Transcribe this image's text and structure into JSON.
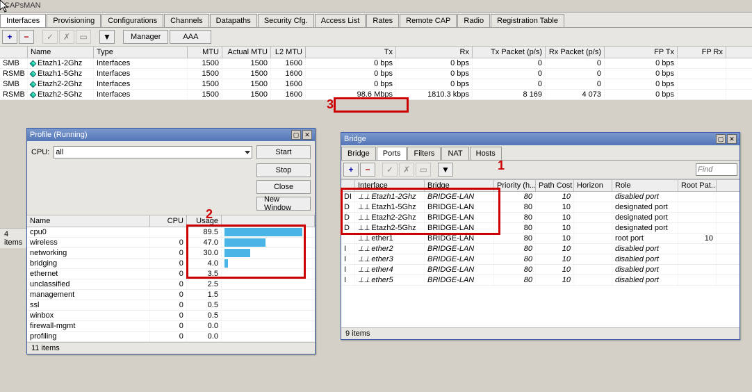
{
  "app": {
    "title": "CAPsMAN"
  },
  "main_tabs": [
    "Interfaces",
    "Provisioning",
    "Configurations",
    "Channels",
    "Datapaths",
    "Security Cfg.",
    "Access List",
    "Rates",
    "Remote CAP",
    "Radio",
    "Registration Table"
  ],
  "toolbar": {
    "manager": "Manager",
    "aaa": "AAA"
  },
  "grid": {
    "headers": [
      "",
      "Name",
      "Type",
      "MTU",
      "Actual MTU",
      "L2 MTU",
      "Tx",
      "Rx",
      "Tx Packet (p/s)",
      "Rx Packet (p/s)",
      "FP Tx",
      "FP Rx"
    ],
    "rows": [
      {
        "flags": "SMB",
        "name": "Etazh1-2Ghz",
        "type": "Interfaces",
        "mtu": "1500",
        "amtu": "1500",
        "l2mtu": "1600",
        "tx": "0 bps",
        "rx": "0 bps",
        "txp": "0",
        "rxp": "0",
        "fptx": "0 bps",
        "fprx": ""
      },
      {
        "flags": "RSMB",
        "name": "Etazh1-5Ghz",
        "type": "Interfaces",
        "mtu": "1500",
        "amtu": "1500",
        "l2mtu": "1600",
        "tx": "0 bps",
        "rx": "0 bps",
        "txp": "0",
        "rxp": "0",
        "fptx": "0 bps",
        "fprx": ""
      },
      {
        "flags": "SMB",
        "name": "Etazh2-2Ghz",
        "type": "Interfaces",
        "mtu": "1500",
        "amtu": "1500",
        "l2mtu": "1600",
        "tx": "0 bps",
        "rx": "0 bps",
        "txp": "0",
        "rxp": "0",
        "fptx": "0 bps",
        "fprx": ""
      },
      {
        "flags": "RSMB",
        "name": "Etazh2-5Ghz",
        "type": "Interfaces",
        "mtu": "1500",
        "amtu": "1500",
        "l2mtu": "1600",
        "tx": "98.6 Mbps",
        "rx": "1810.3 kbps",
        "txp": "8 169",
        "rxp": "4 073",
        "fptx": "0 bps",
        "fprx": ""
      }
    ],
    "status": "4 items"
  },
  "profile": {
    "title": "Profile (Running)",
    "cpu_label": "CPU:",
    "cpu_value": "all",
    "buttons": {
      "start": "Start",
      "stop": "Stop",
      "close": "Close",
      "new_window": "New Window"
    },
    "headers": [
      "Name",
      "CPU",
      "Usage"
    ],
    "rows": [
      {
        "name": "cpu0",
        "cpu": "",
        "usage": "89.5",
        "bar": 89.5
      },
      {
        "name": "wireless",
        "cpu": "0",
        "usage": "47.0",
        "bar": 47.0
      },
      {
        "name": "networking",
        "cpu": "0",
        "usage": "30.0",
        "bar": 30.0
      },
      {
        "name": "bridging",
        "cpu": "0",
        "usage": "4.0",
        "bar": 4.0
      },
      {
        "name": "ethernet",
        "cpu": "0",
        "usage": "3.5",
        "bar": 0
      },
      {
        "name": "unclassified",
        "cpu": "0",
        "usage": "2.5",
        "bar": 0
      },
      {
        "name": "management",
        "cpu": "0",
        "usage": "1.5",
        "bar": 0
      },
      {
        "name": "ssl",
        "cpu": "0",
        "usage": "0.5",
        "bar": 0
      },
      {
        "name": "winbox",
        "cpu": "0",
        "usage": "0.5",
        "bar": 0
      },
      {
        "name": "firewall-mgmt",
        "cpu": "0",
        "usage": "0.0",
        "bar": 0
      },
      {
        "name": "profiling",
        "cpu": "0",
        "usage": "0.0",
        "bar": 0
      }
    ],
    "status": "11 items"
  },
  "bridge": {
    "title": "Bridge",
    "tabs": [
      "Bridge",
      "Ports",
      "Filters",
      "NAT",
      "Hosts"
    ],
    "find_placeholder": "Find",
    "headers": [
      "",
      "Interface",
      "Bridge",
      "Priority (h...",
      "Path Cost",
      "Horizon",
      "Role",
      "Root Pat..."
    ],
    "rows": [
      {
        "flags": "DI",
        "iface": "Etazh1-2Ghz",
        "bridge": "BRIDGE-LAN",
        "prio": "80",
        "cost": "10",
        "hz": "",
        "role": "disabled port",
        "root": "",
        "italic": true
      },
      {
        "flags": "D",
        "iface": "Etazh1-5Ghz",
        "bridge": "BRIDGE-LAN",
        "prio": "80",
        "cost": "10",
        "hz": "",
        "role": "designated port",
        "root": ""
      },
      {
        "flags": "D",
        "iface": "Etazh2-2Ghz",
        "bridge": "BRIDGE-LAN",
        "prio": "80",
        "cost": "10",
        "hz": "",
        "role": "designated port",
        "root": ""
      },
      {
        "flags": "D",
        "iface": "Etazh2-5Ghz",
        "bridge": "BRIDGE-LAN",
        "prio": "80",
        "cost": "10",
        "hz": "",
        "role": "designated port",
        "root": ""
      },
      {
        "flags": "",
        "iface": "ether1",
        "bridge": "BRIDGE-LAN",
        "prio": "80",
        "cost": "10",
        "hz": "",
        "role": "root port",
        "root": "10"
      },
      {
        "flags": "I",
        "iface": "ether2",
        "bridge": "BRIDGE-LAN",
        "prio": "80",
        "cost": "10",
        "hz": "",
        "role": "disabled port",
        "root": "",
        "italic": true
      },
      {
        "flags": "I",
        "iface": "ether3",
        "bridge": "BRIDGE-LAN",
        "prio": "80",
        "cost": "10",
        "hz": "",
        "role": "disabled port",
        "root": "",
        "italic": true
      },
      {
        "flags": "I",
        "iface": "ether4",
        "bridge": "BRIDGE-LAN",
        "prio": "80",
        "cost": "10",
        "hz": "",
        "role": "disabled port",
        "root": "",
        "italic": true
      },
      {
        "flags": "I",
        "iface": "ether5",
        "bridge": "BRIDGE-LAN",
        "prio": "80",
        "cost": "10",
        "hz": "",
        "role": "disabled port",
        "root": "",
        "italic": true
      }
    ],
    "status": "9 items"
  },
  "annotations": {
    "n1": "1",
    "n2": "2",
    "n3": "3"
  }
}
